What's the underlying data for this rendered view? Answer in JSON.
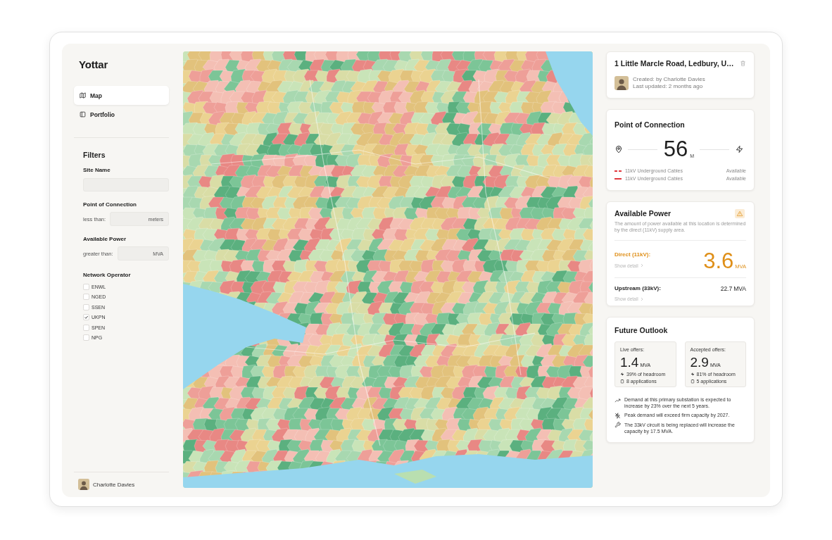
{
  "sidebar": {
    "logo": "Yottar",
    "nav": [
      {
        "kind": "map",
        "label": "Map",
        "selected": true
      },
      {
        "kind": "portfolio",
        "label": "Portfolio",
        "selected": false
      }
    ],
    "filters": {
      "title": "Filters",
      "site_name": {
        "label": "Site Name"
      },
      "point_of_connection": {
        "label": "Point of Connection",
        "prefix": "less than:",
        "unit": "meters"
      },
      "available_power": {
        "label": "Available Power",
        "prefix": "greater than:",
        "unit": "MVA"
      },
      "network_operator": {
        "label": "Network Operator",
        "options": [
          {
            "label": "ENWL",
            "checked": false
          },
          {
            "label": "NGED",
            "checked": false
          },
          {
            "label": "SSEN",
            "checked": false
          },
          {
            "label": "UKPN",
            "checked": true
          },
          {
            "label": "SPEN",
            "checked": false
          },
          {
            "label": "NPG",
            "checked": false
          }
        ]
      }
    },
    "user": {
      "name": "Charlotte Davies"
    }
  },
  "site_card": {
    "title": "1 Little Marcle Road, Ledbury, U…",
    "created": "Created: by Charlotte Davies",
    "updated": "Last updated: 2 months ago"
  },
  "connection_card": {
    "title": "Point of Connection",
    "distance": "56",
    "unit": "M",
    "cables": [
      {
        "kind": "dashed",
        "label": "11kV Underground Cables",
        "status": "Available"
      },
      {
        "kind": "solid",
        "label": "11kV Underground Cables",
        "status": "Available"
      }
    ]
  },
  "power_card": {
    "title": "Available Power",
    "description": "The amount of power available at this location is determined by the direct (11kV) supply area.",
    "rows": [
      {
        "kind": "direct",
        "label": "Direct (11kV):",
        "detail": "Show detail",
        "value": "3.6",
        "unit": "MVA"
      },
      {
        "kind": "upstream",
        "label": "Upstream (33kV):",
        "detail": "Show detail",
        "value": "22.7",
        "unit": "MVA"
      }
    ]
  },
  "outlook_card": {
    "title": "Future Outlook",
    "offers": [
      {
        "label": "Live offers:",
        "value": "1.4",
        "unit": "MVA",
        "headroom": "39% of headroom",
        "applications": "8 applications"
      },
      {
        "label": "Accepted offers:",
        "value": "2.9",
        "unit": "MVA",
        "headroom": "81% of headroom",
        "applications": "5 applications"
      }
    ],
    "notes": [
      {
        "kind": "trend",
        "text": "Demand at this primary substation is expected to increase by 23% over the next 5 years."
      },
      {
        "kind": "capacity",
        "text": "Peak demand will exceed firm capacity by 2027."
      },
      {
        "kind": "upgrade",
        "text": "The 33kV circuit is being replaced will increase the capacity by 17.5 MVA."
      }
    ]
  }
}
